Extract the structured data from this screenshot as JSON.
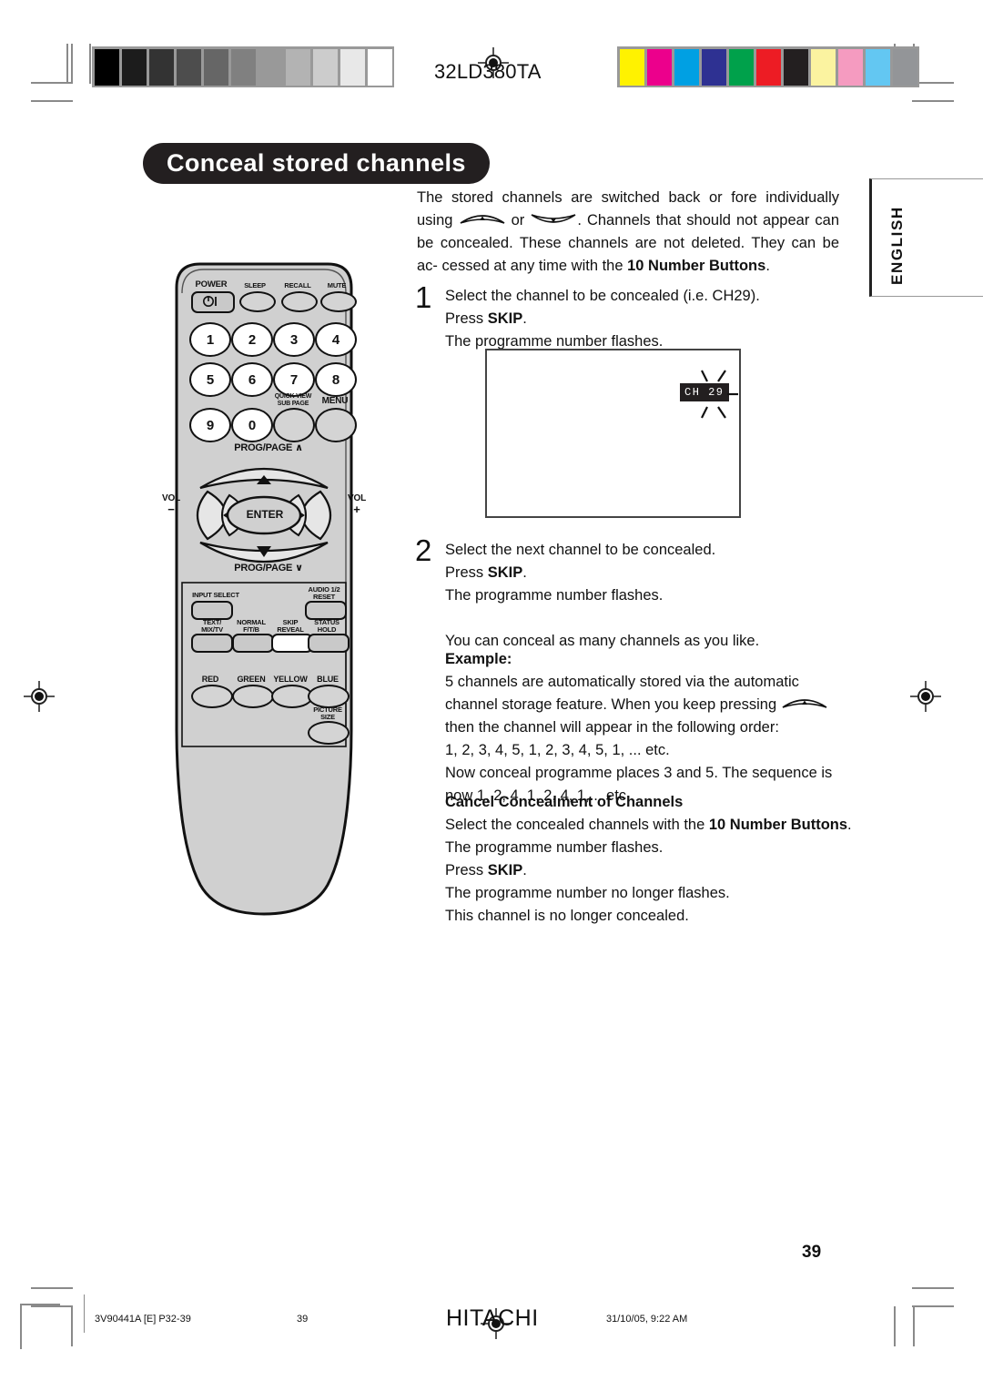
{
  "page": {
    "model": "32LD380TA",
    "language_tab": "ENGLISH",
    "page_number": "39",
    "title": "Conceal stored channels"
  },
  "header": {
    "gray_bars": [
      "#000000",
      "#1c1c1c",
      "#333333",
      "#4d4d4d",
      "#666666",
      "#808080",
      "#999999",
      "#b3b3b3",
      "#cccccc",
      "#e8e8e8",
      "#ffffff"
    ],
    "color_bars": [
      "#fff200",
      "#ec008c",
      "#00a0e3",
      "#2e3192",
      "#00a14b",
      "#ed1c24",
      "#231f20",
      "#fbf3a0",
      "#f59bc0",
      "#63c7f2",
      "#939598"
    ]
  },
  "intro": {
    "line1": "The stored channels are switched back or fore individually using",
    "line2_after_icons": ". Channels that should not appear can be",
    "or_word": "or",
    "line3": "concealed. These channels are not deleted. They can be ac-",
    "line4_prefix": "cessed at any time with the ",
    "line4_bold": "10 Number Buttons",
    "line4_suffix": "."
  },
  "steps": [
    {
      "number": "1",
      "lines": [
        "Select the channel to be concealed (i.e. CH29)."
      ],
      "press_prefix": "Press ",
      "press_bold": "SKIP",
      "press_suffix": ".",
      "after": "The programme number flashes."
    },
    {
      "number": "2",
      "lines": [
        "Select the next channel to be concealed."
      ],
      "press_prefix": "Press ",
      "press_bold": "SKIP",
      "press_suffix": ".",
      "after": "The programme number flashes.",
      "note": "You can conceal as many channels as you like."
    }
  ],
  "tv_illustration": {
    "channel_badge": "CH 29"
  },
  "example": {
    "heading": "Example:",
    "line1": "5 channels are automatically stored via the automatic",
    "line2": "channel storage feature. When you keep pressing",
    "line3": "then the channel will appear in the following order:",
    "line4": "1, 2, 3, 4, 5, 1, 2, 3, 4, 5, 1, ... etc.",
    "line5": "Now conceal programme places 3 and 5. The sequence is",
    "line6": "now 1, 2, 4, 1, 2, 4, 1,... etc."
  },
  "cancel": {
    "heading": "Cancel Concealment of Channels",
    "line1_prefix": "Select the concealed channels with the ",
    "line1_bold": "10 Number Buttons",
    "line1_suffix": ".",
    "line2": "The programme number flashes.",
    "line3_prefix": "Press ",
    "line3_bold": "SKIP",
    "line3_suffix": ".",
    "line4": "The programme number no longer flashes.",
    "line5": "This channel is no longer concealed."
  },
  "remote": {
    "row_top": [
      {
        "label": "POWER",
        "type": "power"
      },
      {
        "label": "SLEEP",
        "type": "oval"
      },
      {
        "label": "RECALL",
        "type": "oval"
      },
      {
        "label": "MUTE",
        "type": "oval"
      }
    ],
    "numbers": [
      "1",
      "2",
      "3",
      "4",
      "5",
      "6",
      "7",
      "8",
      "9",
      "0"
    ],
    "quick_view_label_1": "QUICK VIEW",
    "quick_view_label_2": "SUB PAGE",
    "menu_label": "MENU",
    "prog_page_up": "PROG/PAGE",
    "prog_page_down": "PROG/PAGE",
    "vol_left_label": "VOL",
    "vol_left_sign": "−",
    "vol_right_label": "VOL",
    "vol_right_sign": "+",
    "enter_label": "ENTER",
    "input_select": "INPUT SELECT",
    "audio_reset_1": "AUDIO 1/2",
    "audio_reset_2": "RESET",
    "text_mix_1": "TEXT/",
    "text_mix_2": "MIX/TV",
    "normal_1": "NORMAL",
    "normal_2": "F/T/B",
    "skip_1": "SKIP",
    "skip_2": "REVEAL",
    "status_1": "STATUS",
    "status_2": "HOLD",
    "color_red": "RED",
    "color_green": "GREEN",
    "color_yellow": "YELLOW",
    "color_blue": "BLUE",
    "picture_1": "PICTURE",
    "picture_2": "SIZE"
  },
  "footer": {
    "doc_code": "3V90441A [E] P32-39",
    "page": "39",
    "brand": "HITACHI",
    "timestamp": "31/10/05, 9:22 AM"
  }
}
